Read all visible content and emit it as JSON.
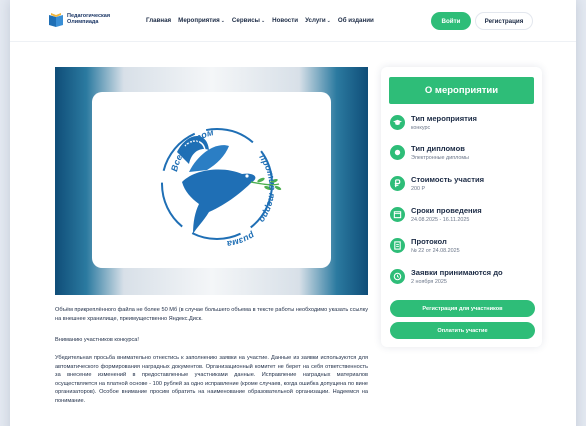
{
  "header": {
    "logo_text_line1": "Педагогическая",
    "logo_text_line2": "Олимпиада",
    "nav": [
      "Главная",
      "Мероприятия",
      "Сервисы",
      "Новости",
      "Услуги",
      "Об издании"
    ],
    "login_label": "Войти",
    "register_label": "Регистрация"
  },
  "banner": {
    "arc_top": "Всем миром",
    "arc_right": "против терро",
    "arc_bottom": "ризма"
  },
  "body": {
    "p1": "Объём прикреплённого файла не более 50 Мб (в случае большего объема в тексте работы необходимо указать ссылку на внешнее хранилище, преимущественно Яндекс.Диск.",
    "p2": "Вниманию участников конкурса!",
    "p3": "Убедительная просьба внимательно отнестись к заполнению заявки на участие. Данные из заявки используются для автоматического формирования наградных документов. Организационный комитет не берет на себя ответственность за внесение изменений в предоставленные участниками данные. Исправление наградных материалов осуществляется на платной основе - 100 рублей за одно исправление (кроме случаев, когда ошибка допущена по вине организаторов). Особое внимание просим обратить на наименование образовательной организации. Надеемся на понимание."
  },
  "sidebar": {
    "title": "О мероприятии",
    "items": [
      {
        "title": "Тип мероприятия",
        "value": "конкурс",
        "icon": "graduation-cap-icon"
      },
      {
        "title": "Тип дипломов",
        "value": "Электронные дипломы",
        "icon": "diploma-icon"
      },
      {
        "title": "Стоимость участия",
        "value": "200 Р",
        "icon": "ruble-icon"
      },
      {
        "title": "Сроки проведения",
        "value": "24.08.2025 - 16.11.2025",
        "icon": "calendar-icon"
      },
      {
        "title": "Протокол",
        "value": "№ 22 от 24.08.2025",
        "icon": "document-icon"
      },
      {
        "title": "Заявки принимаются до",
        "value": "2 ноября 2025",
        "icon": "clock-icon"
      }
    ],
    "btn_register": "Регистрация для участников",
    "btn_pay": "Оплатить участие"
  },
  "colors": {
    "accent": "#2ebd78",
    "text": "#1c2b45",
    "brand_blue": "#1f6fb5"
  }
}
